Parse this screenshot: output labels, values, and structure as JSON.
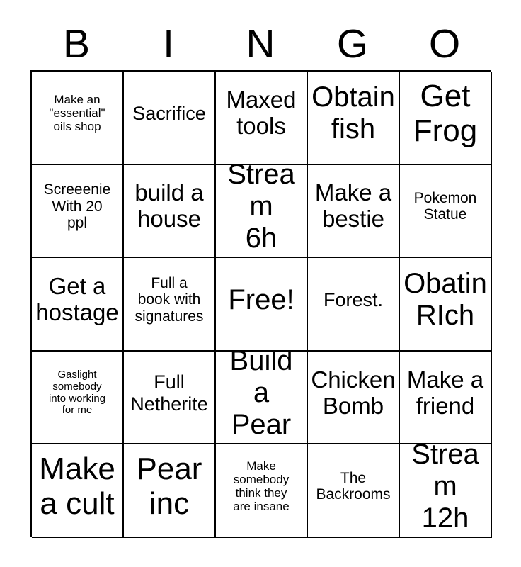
{
  "header": {
    "letters": [
      "B",
      "I",
      "N",
      "G",
      "O"
    ]
  },
  "grid": {
    "columns": 5,
    "rows": 5,
    "cells": [
      {
        "text": "Make an\n\"essential\"\noils shop",
        "size": "fs-sm"
      },
      {
        "text": "Sacrifice",
        "size": "fs-lg"
      },
      {
        "text": "Maxed\ntools",
        "size": "fs-xl"
      },
      {
        "text": "Obtain\nfish",
        "size": "fs-xxl"
      },
      {
        "text": "Get\nFrog",
        "size": "fs-huge"
      },
      {
        "text": "Screeenie\nWith 20\nppl",
        "size": "fs-md"
      },
      {
        "text": "build a\nhouse",
        "size": "fs-xl"
      },
      {
        "text": "Stream\n6h",
        "size": "fs-xxl"
      },
      {
        "text": "Make a\nbestie",
        "size": "fs-xl"
      },
      {
        "text": "Pokemon\nStatue",
        "size": "fs-md"
      },
      {
        "text": "Get a\nhostage",
        "size": "fs-xl"
      },
      {
        "text": "Full a\nbook with\nsignatures",
        "size": "fs-md"
      },
      {
        "text": "Free!",
        "size": "fs-xxl"
      },
      {
        "text": "Forest.",
        "size": "fs-lg"
      },
      {
        "text": "Obatin\nRIch",
        "size": "fs-xxl"
      },
      {
        "text": "Gaslight\nsomebody\ninto working\nfor me",
        "size": "fs-xs"
      },
      {
        "text": "Full\nNetherite",
        "size": "fs-lg"
      },
      {
        "text": "Build a\nPear",
        "size": "fs-xxl"
      },
      {
        "text": "Chicken\nBomb",
        "size": "fs-xl"
      },
      {
        "text": "Make a\nfriend",
        "size": "fs-xl"
      },
      {
        "text": "Make\na cult",
        "size": "fs-huge"
      },
      {
        "text": "Pear\ninc",
        "size": "fs-huge"
      },
      {
        "text": "Make\nsomebody\nthink they\nare insane",
        "size": "fs-sm"
      },
      {
        "text": "The\nBackrooms",
        "size": "fs-md"
      },
      {
        "text": "Stream\n12h",
        "size": "fs-xxl"
      }
    ]
  },
  "colors": {
    "background": "#ffffff",
    "text": "#000000",
    "border": "#000000"
  }
}
